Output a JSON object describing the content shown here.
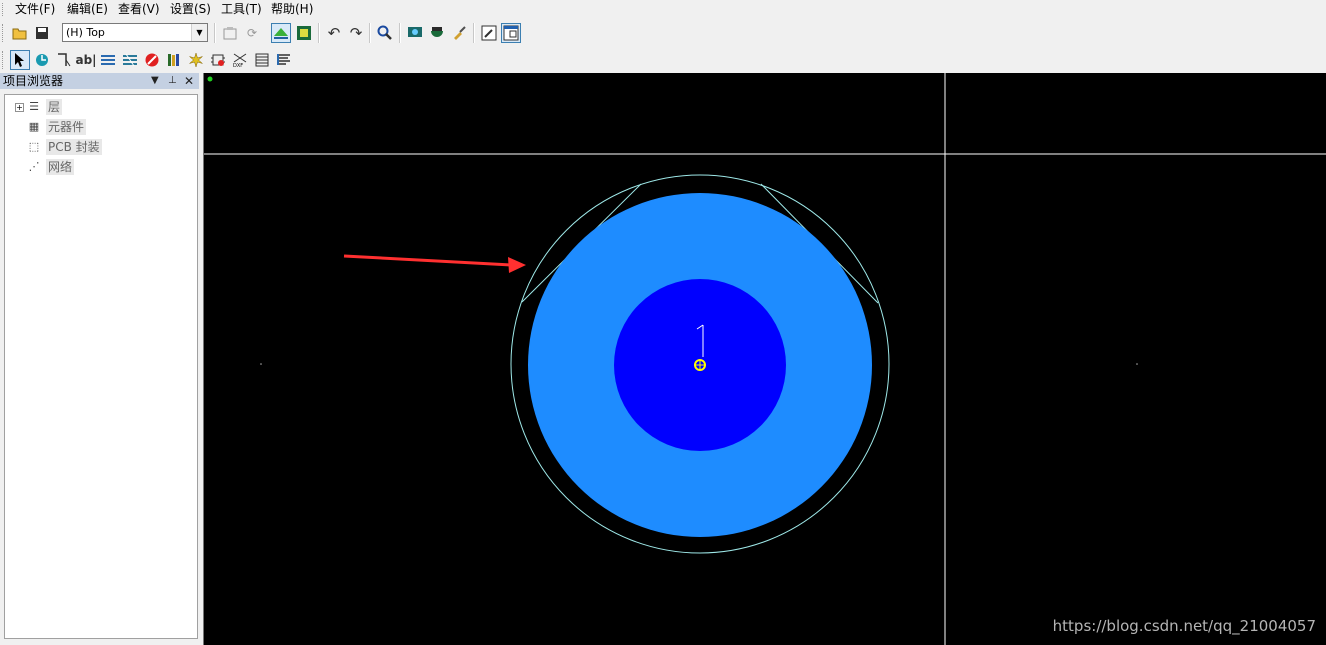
{
  "menu": {
    "items": [
      "文件(F)",
      "编辑(E)",
      "查看(V)",
      "设置(S)",
      "工具(T)",
      "帮助(H)"
    ]
  },
  "toolbar": {
    "layer_select_value": "(H) Top",
    "draw_text_tool_label": "ab|"
  },
  "panel": {
    "title": "项目浏览器",
    "tree": [
      "层",
      "元器件",
      "PCB 封装",
      "网络"
    ]
  },
  "canvas": {
    "pad_colors": {
      "outer": "#1e8cff",
      "inner": "#0000ff",
      "outline": "#9ee8e8",
      "crosshair": "#ffffff",
      "origin": "#ffff00",
      "arrow": "#ff3030"
    }
  },
  "watermark": "https://blog.csdn.net/qq_21004057"
}
